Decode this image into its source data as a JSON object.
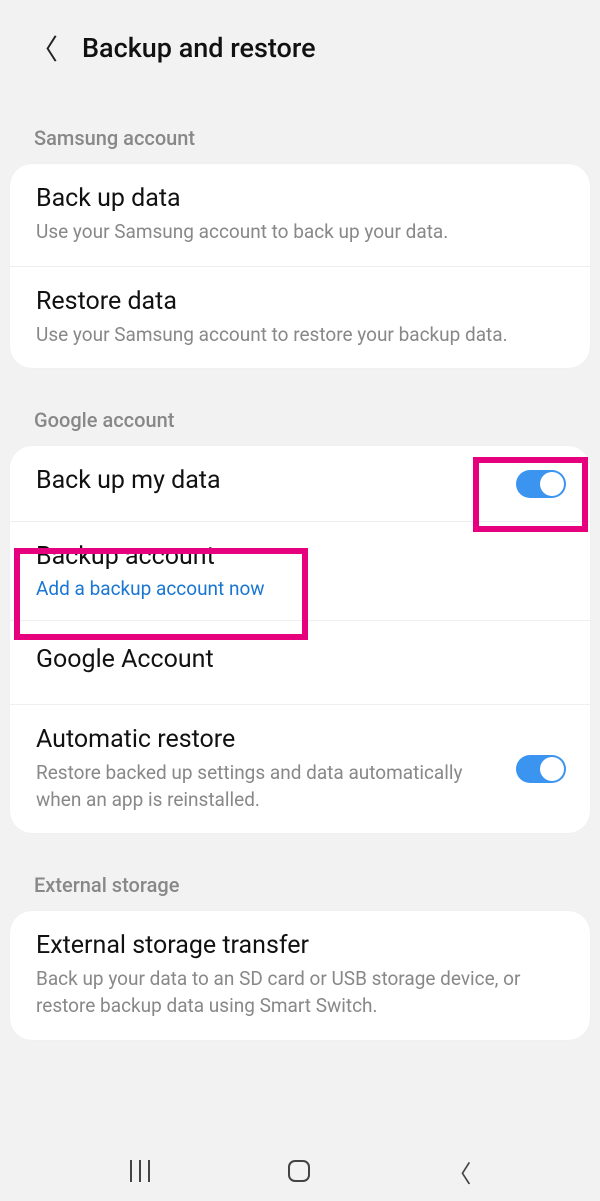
{
  "header": {
    "title": "Backup and restore"
  },
  "sections": {
    "samsung": {
      "label": "Samsung account",
      "items": [
        {
          "title": "Back up data",
          "subtitle": "Use your Samsung account to back up your data."
        },
        {
          "title": "Restore data",
          "subtitle": "Use your Samsung account to restore your backup data."
        }
      ]
    },
    "google": {
      "label": "Google account",
      "backupMyData": {
        "title": "Back up my data"
      },
      "backupAccount": {
        "title": "Backup account",
        "linkText": "Add a backup account now"
      },
      "googleAccount": {
        "title": "Google Account"
      },
      "autoRestore": {
        "title": "Automatic restore",
        "subtitle": "Restore backed up settings and data automatically when an app is reinstalled."
      }
    },
    "external": {
      "label": "External storage",
      "item": {
        "title": "External storage transfer",
        "subtitle": "Back up your data to an SD card or USB storage device, or restore backup data using Smart Switch."
      }
    }
  }
}
